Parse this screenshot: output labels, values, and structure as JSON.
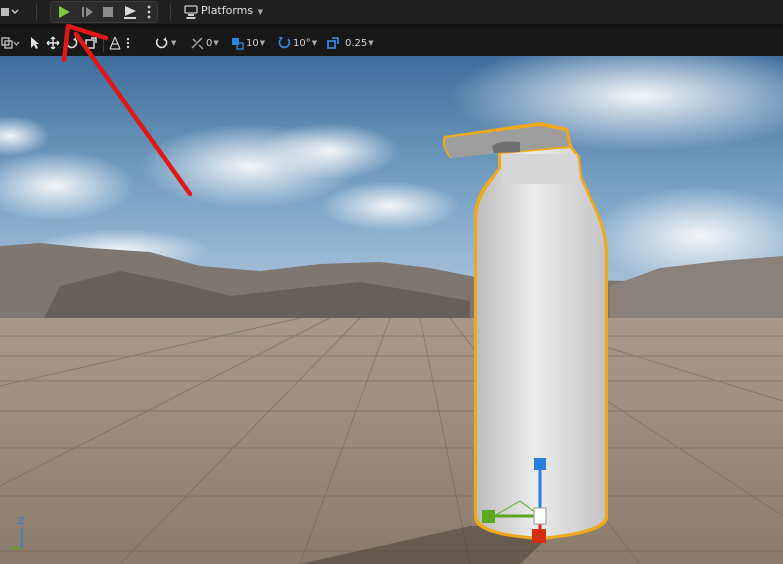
{
  "toolbar": {
    "platforms_label": "Platforms"
  },
  "viewport_toolbar": {
    "translate_snap_value": "0",
    "location_grid_value": "10",
    "rotation_snap_value": "10°",
    "scale_snap_value": "0.25"
  },
  "viewport": {
    "axis_label": "Z"
  },
  "colors": {
    "play_green": "#7ac943",
    "snap_blue": "#2f86e0",
    "selection_outline": "#f0a818",
    "annotation_red": "#e01818",
    "gizmo_x_red": "#d82e10",
    "gizmo_y_green": "#5aa81c",
    "gizmo_z_blue": "#2a7ee0"
  },
  "icons": [
    "level-menu-icon",
    "play-icon",
    "skip-frame-icon",
    "stop-icon",
    "eject-icon",
    "more-options-icon",
    "platforms-icon",
    "perspective-icon",
    "select-icon",
    "translate-icon",
    "rotate-icon",
    "scale-icon",
    "surface-snap-icon",
    "snap-rotation-icon",
    "snap-grid-icon",
    "snap-angle-icon",
    "snap-scale-icon"
  ]
}
